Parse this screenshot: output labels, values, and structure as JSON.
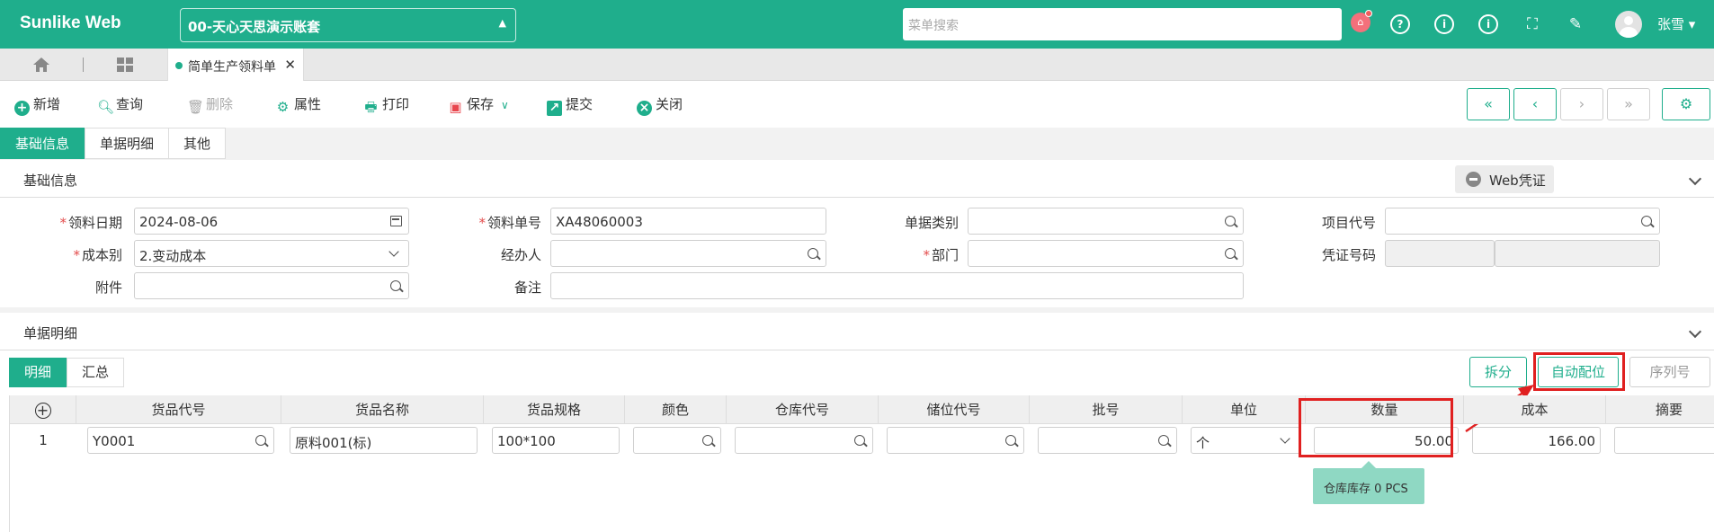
{
  "app": {
    "brand": "Sunlike Web",
    "account": "00-天心天思演示账套",
    "search_placeholder": "菜单搜索",
    "user": "张雪"
  },
  "tabs": {
    "doc_tab": "简单生产领料单"
  },
  "toolbar": {
    "add": "新增",
    "query": "查询",
    "delete": "删除",
    "properties": "属性",
    "print": "打印",
    "save": "保存",
    "submit": "提交",
    "close": "关闭"
  },
  "section_tabs": [
    "基础信息",
    "单据明细",
    "其他"
  ],
  "basic": {
    "title": "基础信息",
    "web_voucher": "Web凭证",
    "fields": {
      "date_label": "领料日期",
      "date_value": "2024-08-06",
      "order_no_label": "领料单号",
      "order_no_value": "XA48060003",
      "doc_type_label": "单据类别",
      "doc_type_value": "",
      "project_label": "项目代号",
      "project_value": "",
      "cost_label": "成本别",
      "cost_value": "2.变动成本",
      "handler_label": "经办人",
      "handler_value": "",
      "dept_label": "部门",
      "dept_value": "",
      "voucher_label": "凭证号码",
      "attach_label": "附件",
      "attach_value": "",
      "remark_label": "备注",
      "remark_value": ""
    }
  },
  "detail": {
    "title": "单据明细",
    "subtabs": [
      "明细",
      "汇总"
    ],
    "buttons": {
      "split": "拆分",
      "auto_locate": "自动配位",
      "serial": "序列号"
    },
    "columns": [
      "货品代号",
      "货品名称",
      "货品规格",
      "颜色",
      "仓库代号",
      "储位代号",
      "批号",
      "单位",
      "数量",
      "成本",
      "摘要"
    ],
    "rows": [
      {
        "index": "1",
        "code": "Y0001",
        "name": "原料001(标)",
        "spec": "100*100",
        "color": "",
        "warehouse": "",
        "location": "",
        "batch": "",
        "unit": "个",
        "qty": "50.00",
        "cost": "166.00",
        "summary": ""
      }
    ],
    "tooltip": "仓库库存   0 PCS"
  },
  "colors": {
    "brand": "#1fae8c",
    "highlight": "#e02020"
  }
}
